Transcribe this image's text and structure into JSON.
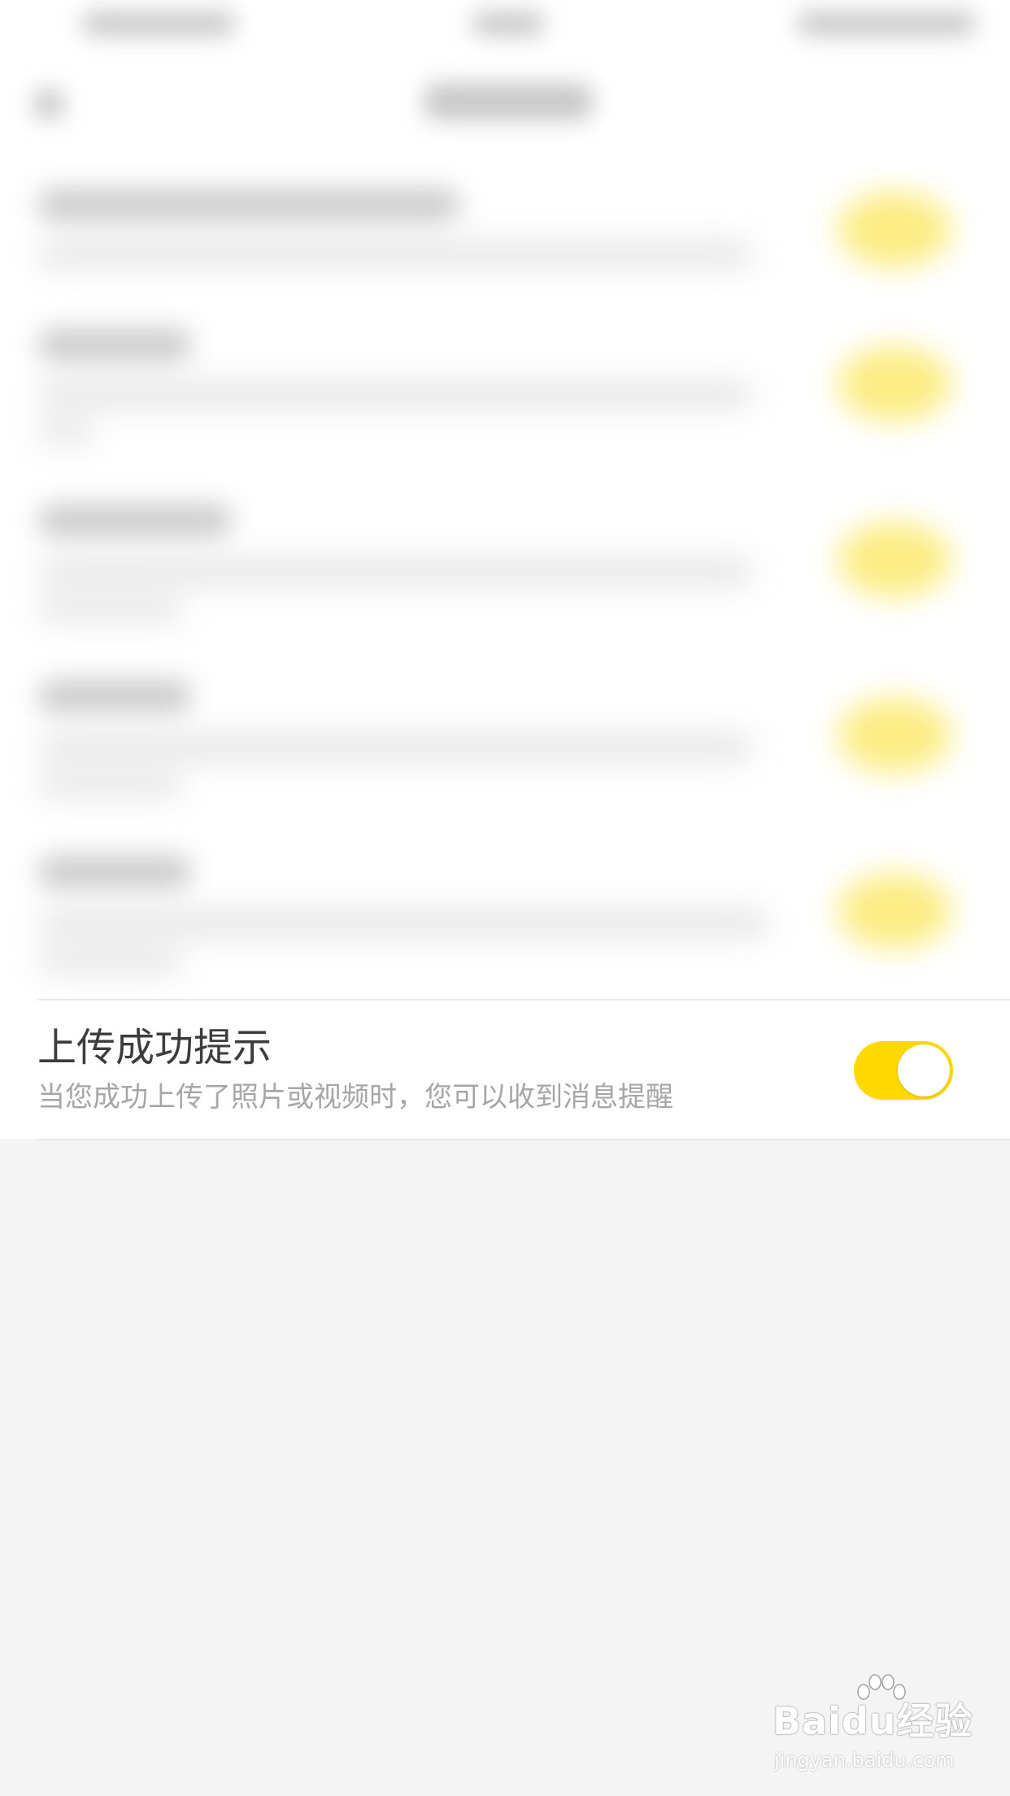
{
  "settings": {
    "upload_success": {
      "title": "上传成功提示",
      "description": "当您成功上传了照片或视频时，您可以收到消息提醒",
      "enabled": true
    }
  },
  "watermark": {
    "logo_text": "Baidu经验",
    "url": "jingyan.baidu.com"
  },
  "colors": {
    "toggle_on": "#ffd900",
    "title_text": "#3c3c3c",
    "desc_text": "#a6a6a6",
    "page_bg": "#f4f4f4"
  }
}
